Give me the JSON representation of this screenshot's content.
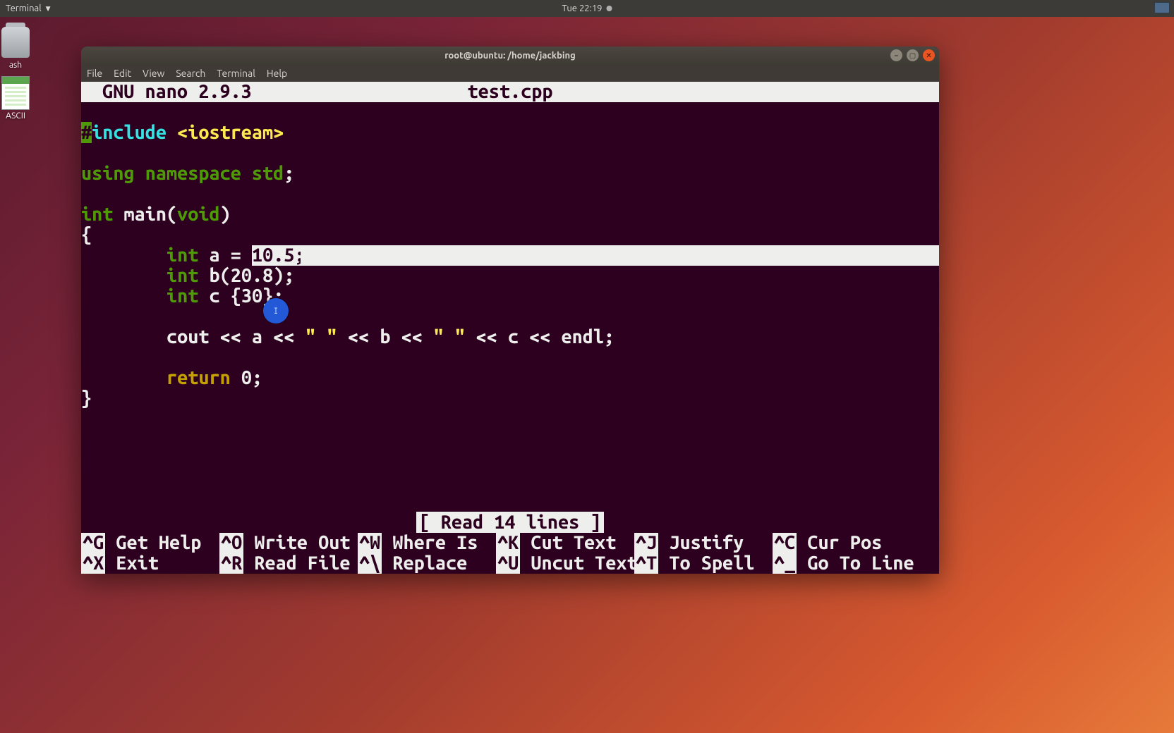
{
  "panel": {
    "menu_label": "Terminal",
    "clock": "Tue 22:19"
  },
  "desktop": {
    "trash_label": "ash",
    "ascii_label": "ASCII"
  },
  "window": {
    "title": "root@ubuntu: /home/jackbing",
    "menubar": [
      "File",
      "Edit",
      "View",
      "Search",
      "Terminal",
      "Help"
    ],
    "controls": {
      "min": "–",
      "max": "▢",
      "close": "✕"
    }
  },
  "nano": {
    "app": "GNU nano 2.9.3",
    "file": "test.cpp",
    "status": "[ Read 14 lines ]",
    "code": {
      "l1": {
        "hash": "#",
        "include": "include",
        "rest": " <iostream>"
      },
      "l3": {
        "using": "using",
        "namespace": " namespace",
        "std": " std",
        "semi": ";"
      },
      "l5": {
        "int": "int",
        "main": " main(",
        "void": "void",
        "close": ")"
      },
      "l6": "{",
      "l7": {
        "indent": "        ",
        "int": "int",
        "rest": " a = ",
        "sel": "10.5;"
      },
      "l8": {
        "indent": "        ",
        "int": "int",
        "rest": " b(",
        "num": "20.8",
        "close": ");"
      },
      "l9": {
        "indent": "        ",
        "int": "int",
        "rest": " c {",
        "num": "30",
        "close": "};"
      },
      "l11": {
        "indent": "        ",
        "text": "cout << a << ",
        "q1": "\" \"",
        "mid": " << b << ",
        "q2": "\" \"",
        "end": " << c << endl;"
      },
      "l13": {
        "indent": "        ",
        "return": "return",
        "sp": " ",
        "zero": "0",
        "semi": ";"
      },
      "l14": "}"
    },
    "shortcuts": {
      "row1": [
        {
          "k": "^G",
          "l": " Get Help   "
        },
        {
          "k": "^O",
          "l": " Write Out  "
        },
        {
          "k": "^W",
          "l": " Where Is   "
        },
        {
          "k": "^K",
          "l": " Cut Text   "
        },
        {
          "k": "^J",
          "l": " Justify    "
        },
        {
          "k": "^C",
          "l": " Cur Pos    "
        }
      ],
      "row2": [
        {
          "k": "^X",
          "l": " Exit       "
        },
        {
          "k": "^R",
          "l": " Read File  "
        },
        {
          "k": "^\\",
          "l": " Replace    "
        },
        {
          "k": "^U",
          "l": " Uncut Text "
        },
        {
          "k": "^T",
          "l": " To Spell   "
        },
        {
          "k": "^_",
          "l": " Go To Line "
        }
      ]
    }
  },
  "annotation": "I"
}
